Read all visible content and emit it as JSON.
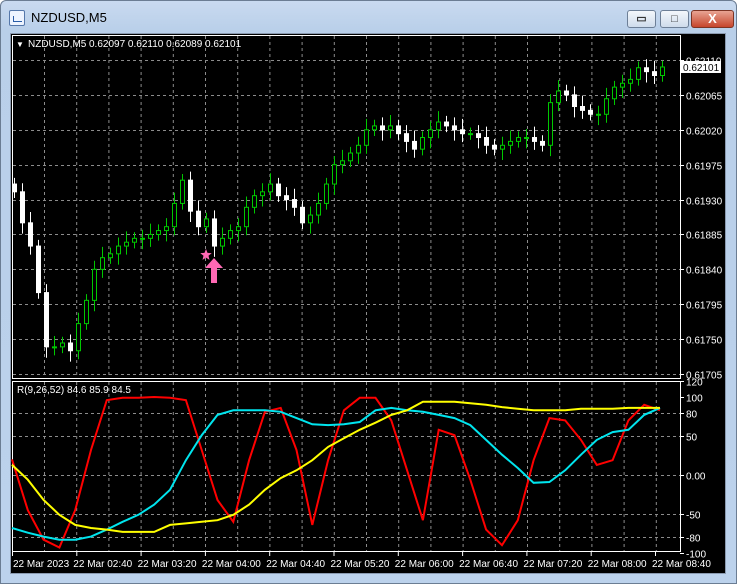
{
  "window": {
    "title": "NZDUSD,M5",
    "minimize_label": "▭",
    "maximize_label": "□",
    "close_label": "X"
  },
  "chart_header": {
    "menu_icon": "▼",
    "symbol": "NZDUSD,M5",
    "ohlc": "0.62097 0.62110 0.62089 0.62101"
  },
  "indicator_header": "R(9,26,52) 84.6 85.9 84.5",
  "colors": {
    "background": "#000000",
    "grid": "#8c8c8c",
    "bull": "#00c800",
    "bear": "#ffffff",
    "red": "#ff0000",
    "cyan": "#00e5ee",
    "yellow": "#ffff00",
    "marker": "#ff69b4"
  },
  "chart_data": [
    {
      "type": "candlestick",
      "title": "NZDUSD,M5",
      "current_price": "0.62101",
      "price_ticks": [
        "0.62110",
        "0.62065",
        "0.62020",
        "0.61975",
        "0.61930",
        "0.61885",
        "0.61840",
        "0.61795",
        "0.61750",
        "0.61705"
      ],
      "ylim": [
        0.61705,
        0.6211
      ],
      "closes": [
        0.6194,
        0.619,
        0.6187,
        0.6181,
        0.6174,
        0.6174,
        0.61745,
        0.61735,
        0.6177,
        0.618,
        0.6184,
        0.61855,
        0.6186,
        0.6187,
        0.61875,
        0.6188,
        0.6188,
        0.61885,
        0.6189,
        0.61895,
        0.61925,
        0.61955,
        0.61915,
        0.61895,
        0.61905,
        0.6187,
        0.6188,
        0.6189,
        0.61895,
        0.6192,
        0.61935,
        0.6194,
        0.6195,
        0.61935,
        0.6193,
        0.6192,
        0.619,
        0.6191,
        0.61925,
        0.6195,
        0.61975,
        0.6198,
        0.6199,
        0.62,
        0.6202,
        0.62025,
        0.6202,
        0.62025,
        0.62015,
        0.62005,
        0.61995,
        0.6201,
        0.6202,
        0.6203,
        0.62025,
        0.6202,
        0.62015,
        0.62015,
        0.6201,
        0.62,
        0.61995,
        0.62,
        0.62005,
        0.6201,
        0.6201,
        0.62005,
        0.62,
        0.62055,
        0.6207,
        0.62065,
        0.6205,
        0.62045,
        0.6204,
        0.6204,
        0.6206,
        0.62075,
        0.6208,
        0.62085,
        0.621,
        0.62095,
        0.6209,
        0.62101
      ],
      "first_open": 0.6195,
      "marker": {
        "type": "buy-arrow-with-star",
        "candle_index": 25
      }
    },
    {
      "type": "line",
      "title": "R(9,26,52)",
      "values_label": "84.6 85.9 84.5",
      "y_ticks": [
        "120",
        "100",
        "80",
        "50",
        "0.00",
        "-50",
        "-80",
        "-100"
      ],
      "y_tick_values": [
        120,
        100,
        80,
        50,
        0,
        -50,
        -80,
        -100
      ],
      "ylim": [
        -110,
        125
      ],
      "x_ticks": [
        "22 Mar 2023",
        "22 Mar 02:40",
        "22 Mar 03:20",
        "22 Mar 04:00",
        "22 Mar 04:40",
        "22 Mar 05:20",
        "22 Mar 06:00",
        "22 Mar 06:40",
        "22 Mar 07:20",
        "22 Mar 08:00",
        "22 Mar 08:40"
      ],
      "series": [
        {
          "name": "fast",
          "color": "#ff0000",
          "values": [
            20,
            -45,
            -83,
            -93,
            -45,
            32,
            96,
            99,
            99,
            100,
            99,
            96,
            32,
            -32,
            -60,
            19,
            81,
            86,
            32,
            -64,
            19,
            83,
            99,
            99,
            70,
            6,
            -58,
            58,
            51,
            -6,
            -70,
            -90,
            -58,
            19,
            73,
            70,
            45,
            13,
            19,
            70,
            90,
            83
          ]
        },
        {
          "name": "medium",
          "color": "#00e5ee",
          "values": [
            -68,
            -74,
            -79,
            -83,
            -83,
            -79,
            -70,
            -60,
            -51,
            -38,
            -19,
            19,
            51,
            77,
            83,
            83,
            83,
            81,
            73,
            65,
            64,
            65,
            68,
            83,
            86,
            83,
            81,
            77,
            73,
            64,
            45,
            26,
            9,
            -10,
            -9,
            6,
            26,
            45,
            55,
            58,
            77,
            86
          ]
        },
        {
          "name": "slow",
          "color": "#ffff00",
          "values": [
            13,
            -6,
            -32,
            -51,
            -64,
            -68,
            -70,
            -73,
            -73,
            -73,
            -64,
            -62,
            -60,
            -58,
            -51,
            -38,
            -19,
            -4,
            6,
            19,
            36,
            47,
            58,
            67,
            77,
            83,
            94,
            94,
            94,
            92,
            90,
            87,
            85,
            83,
            83,
            83,
            85,
            85,
            85,
            86,
            86,
            86
          ]
        }
      ]
    }
  ]
}
